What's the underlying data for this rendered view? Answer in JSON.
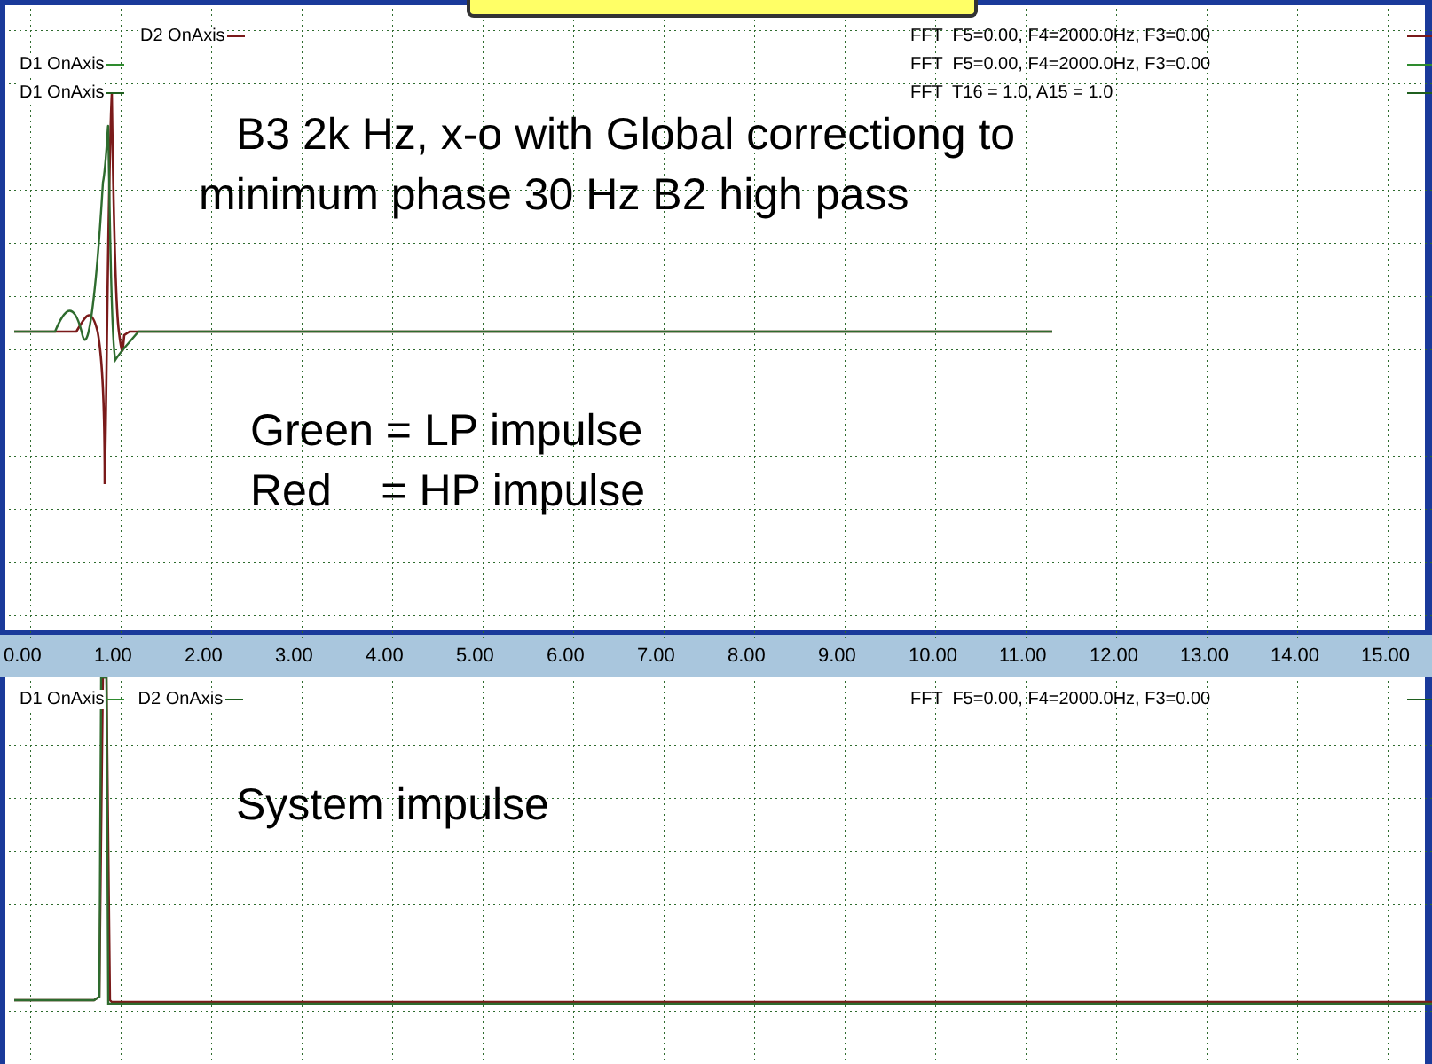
{
  "top_panel": {
    "legend": [
      {
        "label": "D2 OnAxis",
        "color": "#7a1a1a"
      },
      {
        "label": "D1 OnAxis",
        "color": "#2e8b2e"
      },
      {
        "label": "D1 OnAxis",
        "color": "#1f5f1f"
      }
    ],
    "fft_notes": [
      {
        "text": "FFT  F5=0.00, F4=2000.0Hz, F3=0.00",
        "color": "#7a1a1a"
      },
      {
        "text": "FFT  F5=0.00, F4=2000.0Hz, F3=0.00",
        "color": "#2e8b2e"
      },
      {
        "text": "FFT  T16 = 1.0, A15 = 1.0",
        "color": "#1f5f1f"
      }
    ],
    "annotations": [
      "B3 2k Hz, x-o with Global correctiong to",
      "minimum phase 30 Hz B2 high pass",
      "Green = LP impulse",
      "Red    = HP impulse"
    ]
  },
  "x_axis": {
    "ticks": [
      "0.00",
      "1.00",
      "2.00",
      "3.00",
      "4.00",
      "5.00",
      "6.00",
      "7.00",
      "8.00",
      "9.00",
      "10.00",
      "11.00",
      "12.00",
      "13.00",
      "14.00",
      "15.00"
    ]
  },
  "bottom_panel": {
    "legend": [
      {
        "label": "D1 OnAxis",
        "color": "#2e8b2e"
      },
      {
        "label": "D2 OnAxis",
        "color": "#1f5f1f"
      }
    ],
    "fft_notes": [
      {
        "text": "FFT  F5=0.00, F4=2000.0Hz, F3=0.00",
        "color": "#1f5f1f"
      }
    ],
    "annotations": [
      "System impulse"
    ]
  }
}
